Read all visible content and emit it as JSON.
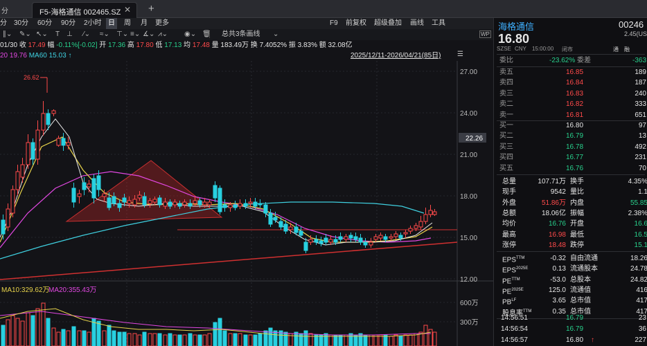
{
  "tabbar": {
    "partial_left": "分",
    "title": "F5-海格通信 002465.SZ",
    "close": "✕",
    "add": "+"
  },
  "toolbar": {
    "items": [
      "30分",
      "60分",
      "90分",
      "2小时",
      "日",
      "周",
      "月",
      "更多"
    ],
    "selected": "日",
    "right": [
      "F9",
      "前复权",
      "超级叠加",
      "画线",
      "工具"
    ],
    "drawing_select": "总共3条画线"
  },
  "stock": {
    "name": "海格通信",
    "code_partial": "00246",
    "price": "16.80",
    "change_partial": "2.45(US",
    "exchange": "SZSE",
    "currency": "CNY",
    "time": "15:00:00",
    "status": "闭市",
    "tag1": "通",
    "tag2": "融",
    "chart_icon": "↑"
  },
  "infobar": {
    "date": "01/30",
    "close_label": "收",
    "close": "17.49",
    "range_label": "幅",
    "range": "-0.11%[-0.02]",
    "open_label": "开",
    "open": "17.36",
    "high_label": "高",
    "high": "17.80",
    "low_label": "低",
    "low": "17.13",
    "avg_label": "均",
    "avg": "17.48",
    "vol_label": "量",
    "vol": "183.49万",
    "turnover_label": "换",
    "turnover": "7.4052%",
    "amp_label": "振",
    "amp": "3.83%",
    "amount_label": "额",
    "amount": "32.08亿"
  },
  "mabar": {
    "ma20": "20 19.76",
    "ma60": "MA60 15.03",
    "arrow": "↑",
    "range": "2025/12/11-2026/04/21(85日)"
  },
  "chart": {
    "y_ticks": [
      "27.00",
      "24.00",
      "21.00",
      "18.00",
      "15.00",
      "12.00"
    ],
    "price_marker": "22.26",
    "high_label": "26.62",
    "vol_ma10": "MA10:329.62万",
    "vol_ma20": "MA20:355.43万",
    "vol_ticks": [
      "600万",
      "300万"
    ],
    "colors": {
      "up": "#ff4a4a",
      "down": "#28d0e0",
      "ma5": "#ffffff",
      "ma10": "#e6d24a",
      "ma20": "#e248e2",
      "ma60": "#3fd0e0"
    }
  },
  "rpanel": {
    "webi_label": "委比",
    "webi": "-23.62%",
    "weicha_label": "委差",
    "weicha": "-363",
    "asks": [
      {
        "label": "卖五",
        "price": "16.85",
        "vol": "189"
      },
      {
        "label": "卖四",
        "price": "16.84",
        "vol": "187"
      },
      {
        "label": "卖三",
        "price": "16.83",
        "vol": "240"
      },
      {
        "label": "卖二",
        "price": "16.82",
        "vol": "333"
      },
      {
        "label": "卖一",
        "price": "16.81",
        "vol": "651"
      }
    ],
    "bids": [
      {
        "label": "买一",
        "price": "16.80",
        "vol": "97"
      },
      {
        "label": "买二",
        "price": "16.79",
        "vol": "13"
      },
      {
        "label": "买三",
        "price": "16.78",
        "vol": "492"
      },
      {
        "label": "买四",
        "price": "16.77",
        "vol": "231"
      },
      {
        "label": "买五",
        "price": "16.76",
        "vol": "70"
      }
    ],
    "stats": [
      {
        "l1": "总量",
        "v1": "107.71万",
        "c1": "white",
        "l2": "换手",
        "v2": "4.35%",
        "c2": "white"
      },
      {
        "l1": "现手",
        "v1": "9542",
        "c1": "white",
        "l2": "量比",
        "v2": "1.1",
        "c2": "white"
      },
      {
        "l1": "外盘",
        "v1": "51.86万",
        "c1": "red",
        "l2": "内盘",
        "v2": "55.85",
        "c2": "green"
      },
      {
        "l1": "总额",
        "v1": "18.06亿",
        "c1": "white",
        "l2": "振幅",
        "v2": "2.38%",
        "c2": "white"
      },
      {
        "l1": "均价",
        "v1": "16.76",
        "c1": "green",
        "l2": "开盘",
        "v2": "16.6",
        "c2": "green"
      },
      {
        "l1": "最高",
        "v1": "16.98",
        "c1": "red",
        "l2": "最低",
        "v2": "16.5",
        "c2": "green"
      },
      {
        "l1": "涨停",
        "v1": "18.48",
        "c1": "red",
        "l2": "跌停",
        "v2": "15.1",
        "c2": "green"
      }
    ],
    "fin": [
      {
        "l1": "EPS",
        "s1": "TTM",
        "v1": "-0.32",
        "l2": "自由流通",
        "v2": "18.26"
      },
      {
        "l1": "EPS",
        "s1": "2025E",
        "v1": "0.13",
        "l2": "流通股本",
        "v2": "24.78"
      },
      {
        "l1": "PE",
        "s1": "TTM",
        "v1": "-53.0",
        "l2": "总股本",
        "v2": "24.82"
      },
      {
        "l1": "PE",
        "s1": "2025E",
        "v1": "125.0",
        "l2": "流通值",
        "v2": "416"
      },
      {
        "l1": "PB",
        "s1": "LF",
        "v1": "3.65",
        "l2": "总市值",
        "v2": "417"
      },
      {
        "l1": "股息率",
        "s1": "TTM",
        "v1": "0.35",
        "l2": "总市值",
        "v2": "417"
      }
    ],
    "ticks": [
      {
        "time": "14:56:51",
        "price": "16.79",
        "vol": "23",
        "color": "green"
      },
      {
        "time": "14:56:54",
        "price": "16.79",
        "vol": "36",
        "color": "green"
      },
      {
        "time": "14:56:57",
        "price": "16.80",
        "vol": "227",
        "color": "white"
      }
    ]
  }
}
